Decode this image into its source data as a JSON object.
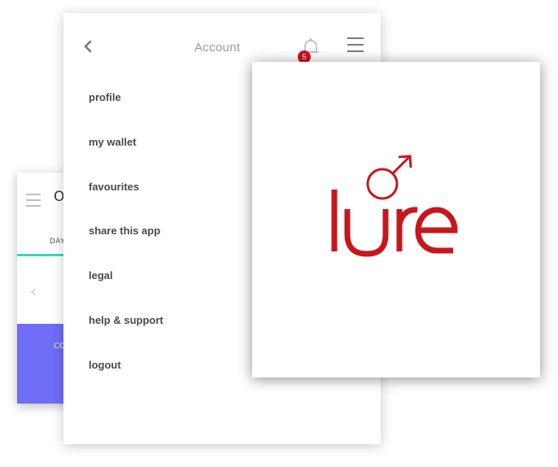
{
  "back_screen": {
    "title_partial": "O",
    "tab_partial": "DAY",
    "banner_partial": "CO"
  },
  "account": {
    "title": "Account",
    "notification_count": "5",
    "menu": [
      "profile",
      "my wallet",
      "favourites",
      "share this app",
      "legal",
      "help & support",
      "logout"
    ]
  },
  "logo": {
    "text": "lure",
    "color": "#c8161d"
  },
  "colors": {
    "accent_teal": "#3fd3c1",
    "banner_purple": "#6f6cf5",
    "badge_red": "#c8161d"
  }
}
